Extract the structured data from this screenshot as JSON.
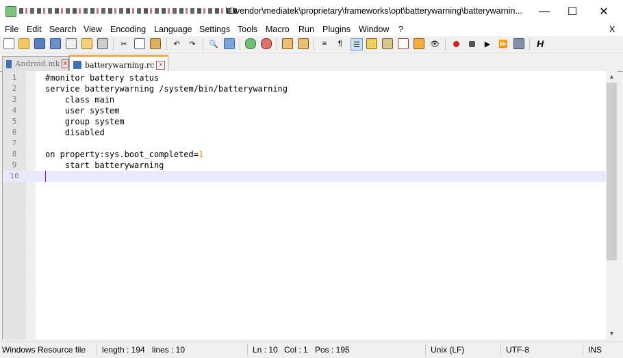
{
  "window": {
    "title": "\\1\\vendor\\mediatek\\proprietary\\frameworks\\opt\\batterywarning\\batterywarnin...",
    "controls": {
      "minimize": "—",
      "maximize": "☐",
      "close": "✕"
    }
  },
  "menu": {
    "items": [
      "File",
      "Edit",
      "Search",
      "View",
      "Encoding",
      "Language",
      "Settings",
      "Tools",
      "Macro",
      "Run",
      "Plugins",
      "Window",
      "?"
    ],
    "close": "X"
  },
  "toolbar": {
    "buttons": [
      "new-file",
      "open-file",
      "save",
      "save-all",
      "close",
      "close-all",
      "print",
      "cut",
      "copy",
      "paste",
      "undo",
      "redo",
      "find",
      "replace",
      "zoom-in",
      "zoom-out",
      "sync-vertical",
      "sync-horizontal",
      "word-wrap",
      "show-all-characters",
      "indent-guide",
      "user-defined-language",
      "document-map",
      "function-list",
      "folder-as-workspace",
      "monitoring",
      "record-macro",
      "stop-recording",
      "playback-macro",
      "run-macro-multiple",
      "save-macro",
      "spell-check"
    ]
  },
  "tabs": [
    {
      "label": "Android.mk",
      "active": false
    },
    {
      "label": "batterywarning.rc",
      "active": true
    }
  ],
  "editor": {
    "lines": [
      {
        "n": "1",
        "text": "#monitor battery status",
        "type": "comment"
      },
      {
        "n": "2",
        "text": "service batterywarning /system/bin/batterywarning",
        "type": "plain"
      },
      {
        "n": "3",
        "text": "    class main",
        "type": "plain"
      },
      {
        "n": "4",
        "text": "    user system",
        "type": "plain"
      },
      {
        "n": "5",
        "text": "    group system",
        "type": "plain"
      },
      {
        "n": "6",
        "text": "    disabled",
        "type": "plain"
      },
      {
        "n": "7",
        "text": "",
        "type": "plain"
      },
      {
        "n": "8",
        "text": "on property:sys.boot_completed=",
        "number": "1",
        "type": "mixed"
      },
      {
        "n": "9",
        "text": "    start batterywarning",
        "type": "plain"
      },
      {
        "n": "10",
        "text": "",
        "type": "current"
      }
    ],
    "colors": {
      "comment": "#b38600",
      "number": "#ff8000",
      "current_line": "#e8e8ff",
      "caret": "#8000ff"
    }
  },
  "status": {
    "file_type": "Windows Resource file",
    "length": "length : 194",
    "lines": "lines : 10",
    "ln": "Ln : 10",
    "col": "Col : 1",
    "pos": "Pos : 195",
    "eol": "Unix (LF)",
    "encoding": "UTF-8",
    "mode": "INS"
  }
}
